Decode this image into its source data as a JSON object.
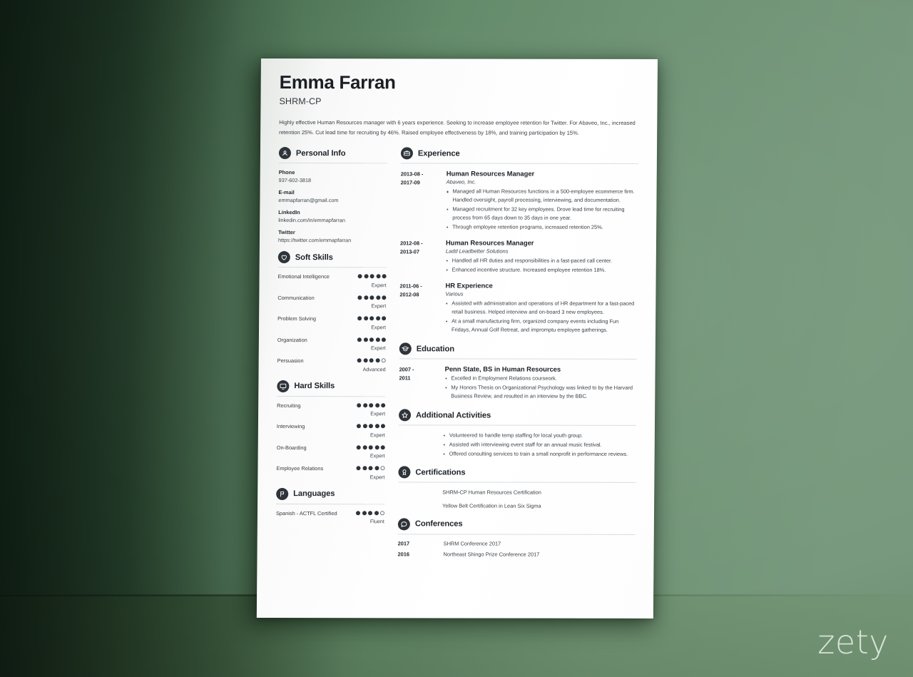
{
  "brand": {
    "logo_text": "zety"
  },
  "resume": {
    "name": "Emma Farran",
    "title": "SHRM-CP",
    "summary": "Highly effective Human Resources manager with 6 years experience. Seeking to increase employee retention for Twitter. For Abaveo, Inc., increased retention 25%. Cut lead time for recruiting by 46%. Raised employee effectiveness by 18%, and training participation by 15%.",
    "personal_info": {
      "heading": "Personal Info",
      "icon": "person-icon",
      "items": [
        {
          "label": "Phone",
          "value": "937-602-3818"
        },
        {
          "label": "E-mail",
          "value": "emmapfarran@gmail.com"
        },
        {
          "label": "LinkedIn",
          "value": "linkedin.com/in/emmapfarran"
        },
        {
          "label": "Twitter",
          "value": "https://twitter.com/emmapfarran"
        }
      ]
    },
    "soft_skills": {
      "heading": "Soft Skills",
      "icon": "heart-icon",
      "items": [
        {
          "name": "Emotional Intelligence",
          "filled": 5,
          "total": 5,
          "level": "Expert"
        },
        {
          "name": "Communication",
          "filled": 5,
          "total": 5,
          "level": "Expert"
        },
        {
          "name": "Problem Solving",
          "filled": 5,
          "total": 5,
          "level": "Expert"
        },
        {
          "name": "Organization",
          "filled": 5,
          "total": 5,
          "level": "Expert"
        },
        {
          "name": "Persuasion",
          "filled": 4,
          "total": 5,
          "level": "Advanced"
        }
      ]
    },
    "hard_skills": {
      "heading": "Hard Skills",
      "icon": "monitor-icon",
      "items": [
        {
          "name": "Recruiting",
          "filled": 5,
          "total": 5,
          "level": "Expert"
        },
        {
          "name": "Interviewing",
          "filled": 5,
          "total": 5,
          "level": "Expert"
        },
        {
          "name": "On-Boarding",
          "filled": 5,
          "total": 5,
          "level": "Expert"
        },
        {
          "name": "Employee Relations",
          "filled": 4,
          "total": 5,
          "level": "Expert"
        }
      ]
    },
    "languages": {
      "heading": "Languages",
      "icon": "flag-icon",
      "items": [
        {
          "name": "Spanish - ACTFL Certified",
          "filled": 4,
          "total": 5,
          "level": "Fluent"
        }
      ]
    },
    "experience": {
      "heading": "Experience",
      "icon": "briefcase-icon",
      "entries": [
        {
          "date": "2013-08 - 2017-09",
          "role": "Human Resources Manager",
          "org": "Abaveo, Inc.",
          "bullets": [
            "Managed all Human Resources functions in a 500-employee ecommerce firm. Handled oversight, payroll processing, interviewing, and documentation.",
            "Managed recruitment for 32 key employees. Drove lead time for recruiting process from 65 days down to 35 days in one year.",
            "Through employee retention programs, increased retention 25%."
          ]
        },
        {
          "date": "2012-08 - 2013-07",
          "role": "Human Resources Manager",
          "org": "Ladd Leadbetter Solutions",
          "bullets": [
            "Handled all HR duties and responsibilities in a fast-paced call center.",
            "Enhanced incentive structure. Increased employee retention 18%."
          ]
        },
        {
          "date": "2011-06 - 2012-08",
          "role": "HR Experience",
          "org": "Various",
          "bullets": [
            "Assisted with administration and operations of HR department for a fast-paced retail business. Helped interview and on-board 3 new employees.",
            "At a small manufacturing firm, organized company events including Fun Fridays, Annual Golf Retreat, and impromptu employee gatherings."
          ]
        }
      ]
    },
    "education": {
      "heading": "Education",
      "icon": "graduation-cap-icon",
      "entries": [
        {
          "date": "2007 - 2011",
          "role": "Penn State, BS in Human Resources",
          "org": "",
          "bullets": [
            "Excelled in Employment Relations courseork.",
            "My Honors Thesis on Organizational Psychology was linked to by the Harvard Business Review, and resulted in an interview by the BBC."
          ]
        }
      ]
    },
    "additional_activities": {
      "heading": "Additional Activities",
      "icon": "star-icon",
      "bullets": [
        "Volunteered to handle temp staffing for local youth group.",
        "Assisted with interviewing event staff for an annual music festival.",
        "Offered consulting services to train a small nonprofit in performance reviews."
      ]
    },
    "certifications": {
      "heading": "Certifications",
      "icon": "award-icon",
      "items": [
        "SHRM-CP Human Resources Certification",
        "Yellow Belt Certification in Lean Six Sigma"
      ]
    },
    "conferences": {
      "heading": "Conferences",
      "icon": "speech-bubble-icon",
      "items": [
        {
          "year": "2017",
          "name": "SHRM Conference 2017"
        },
        {
          "year": "2016",
          "name": "Northeast Shingo Prize Conference 2017"
        }
      ]
    }
  }
}
